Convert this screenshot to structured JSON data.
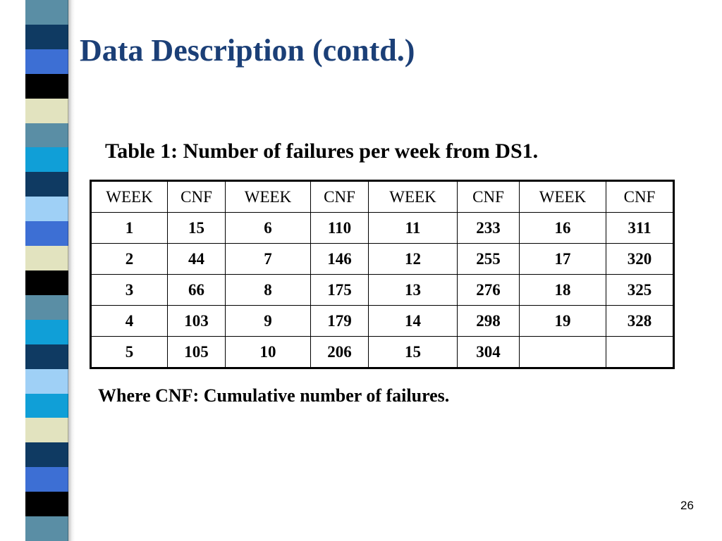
{
  "slide": {
    "title": "Data Description (contd.)",
    "table_caption": "Table 1: Number of failures per week from DS1.",
    "note": "Where CNF: Cumulative number of failures.",
    "page_number": "26"
  },
  "table": {
    "headers": [
      "WEEK",
      "CNF",
      "WEEK",
      "CNF",
      "WEEK",
      "CNF",
      "WEEK",
      "CNF"
    ],
    "rows": [
      [
        "1",
        "15",
        "6",
        "110",
        "11",
        "233",
        "16",
        "311"
      ],
      [
        "2",
        "44",
        "7",
        "146",
        "12",
        "255",
        "17",
        "320"
      ],
      [
        "3",
        "66",
        "8",
        "175",
        "13",
        "276",
        "18",
        "325"
      ],
      [
        "4",
        "103",
        "9",
        "179",
        "14",
        "298",
        "19",
        "328"
      ],
      [
        "5",
        "105",
        "10",
        "206",
        "15",
        "304",
        "",
        ""
      ]
    ]
  },
  "colors": {
    "title": "#1b3f77",
    "strip_navy": "#0f3a62",
    "strip_blue": "#3d6fd4",
    "strip_black": "#000000",
    "strip_cream": "#e2e3bf",
    "strip_steel": "#5a8ea5",
    "strip_cyan": "#109fd7",
    "strip_light": "#9fd0f6"
  },
  "decoration": {
    "strip_pattern": [
      "steel",
      "navy",
      "blue",
      "black",
      "cream",
      "steel",
      "cyan",
      "navy",
      "light",
      "blue",
      "cream",
      "black",
      "steel",
      "cyan",
      "navy",
      "light",
      "cyan",
      "cream",
      "navy",
      "blue",
      "black",
      "steel"
    ]
  }
}
